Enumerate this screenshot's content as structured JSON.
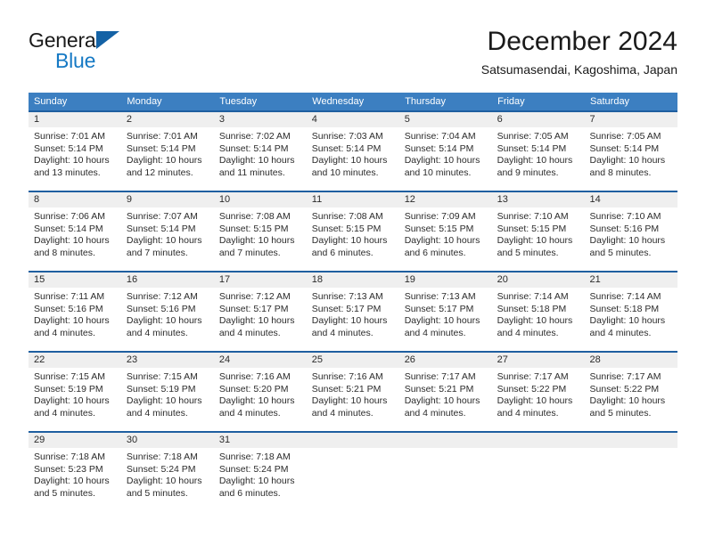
{
  "brand": {
    "name_part1": "General",
    "name_part2": "Blue",
    "triangle_color": "#1462a5",
    "blue_color": "#1579c4"
  },
  "header": {
    "month_title": "December 2024",
    "location": "Satsumasendai, Kagoshima, Japan"
  },
  "theme": {
    "header_row_bg": "#3c7fc1",
    "week_divider": "#1f5fa0",
    "daynum_bg": "#efefef",
    "text": "#2b2b2b"
  },
  "calendar": {
    "weekdays": [
      "Sunday",
      "Monday",
      "Tuesday",
      "Wednesday",
      "Thursday",
      "Friday",
      "Saturday"
    ],
    "weeks": [
      [
        {
          "day": "1",
          "sunrise": "Sunrise: 7:01 AM",
          "sunset": "Sunset: 5:14 PM",
          "daylight": "Daylight: 10 hours and 13 minutes."
        },
        {
          "day": "2",
          "sunrise": "Sunrise: 7:01 AM",
          "sunset": "Sunset: 5:14 PM",
          "daylight": "Daylight: 10 hours and 12 minutes."
        },
        {
          "day": "3",
          "sunrise": "Sunrise: 7:02 AM",
          "sunset": "Sunset: 5:14 PM",
          "daylight": "Daylight: 10 hours and 11 minutes."
        },
        {
          "day": "4",
          "sunrise": "Sunrise: 7:03 AM",
          "sunset": "Sunset: 5:14 PM",
          "daylight": "Daylight: 10 hours and 10 minutes."
        },
        {
          "day": "5",
          "sunrise": "Sunrise: 7:04 AM",
          "sunset": "Sunset: 5:14 PM",
          "daylight": "Daylight: 10 hours and 10 minutes."
        },
        {
          "day": "6",
          "sunrise": "Sunrise: 7:05 AM",
          "sunset": "Sunset: 5:14 PM",
          "daylight": "Daylight: 10 hours and 9 minutes."
        },
        {
          "day": "7",
          "sunrise": "Sunrise: 7:05 AM",
          "sunset": "Sunset: 5:14 PM",
          "daylight": "Daylight: 10 hours and 8 minutes."
        }
      ],
      [
        {
          "day": "8",
          "sunrise": "Sunrise: 7:06 AM",
          "sunset": "Sunset: 5:14 PM",
          "daylight": "Daylight: 10 hours and 8 minutes."
        },
        {
          "day": "9",
          "sunrise": "Sunrise: 7:07 AM",
          "sunset": "Sunset: 5:14 PM",
          "daylight": "Daylight: 10 hours and 7 minutes."
        },
        {
          "day": "10",
          "sunrise": "Sunrise: 7:08 AM",
          "sunset": "Sunset: 5:15 PM",
          "daylight": "Daylight: 10 hours and 7 minutes."
        },
        {
          "day": "11",
          "sunrise": "Sunrise: 7:08 AM",
          "sunset": "Sunset: 5:15 PM",
          "daylight": "Daylight: 10 hours and 6 minutes."
        },
        {
          "day": "12",
          "sunrise": "Sunrise: 7:09 AM",
          "sunset": "Sunset: 5:15 PM",
          "daylight": "Daylight: 10 hours and 6 minutes."
        },
        {
          "day": "13",
          "sunrise": "Sunrise: 7:10 AM",
          "sunset": "Sunset: 5:15 PM",
          "daylight": "Daylight: 10 hours and 5 minutes."
        },
        {
          "day": "14",
          "sunrise": "Sunrise: 7:10 AM",
          "sunset": "Sunset: 5:16 PM",
          "daylight": "Daylight: 10 hours and 5 minutes."
        }
      ],
      [
        {
          "day": "15",
          "sunrise": "Sunrise: 7:11 AM",
          "sunset": "Sunset: 5:16 PM",
          "daylight": "Daylight: 10 hours and 4 minutes."
        },
        {
          "day": "16",
          "sunrise": "Sunrise: 7:12 AM",
          "sunset": "Sunset: 5:16 PM",
          "daylight": "Daylight: 10 hours and 4 minutes."
        },
        {
          "day": "17",
          "sunrise": "Sunrise: 7:12 AM",
          "sunset": "Sunset: 5:17 PM",
          "daylight": "Daylight: 10 hours and 4 minutes."
        },
        {
          "day": "18",
          "sunrise": "Sunrise: 7:13 AM",
          "sunset": "Sunset: 5:17 PM",
          "daylight": "Daylight: 10 hours and 4 minutes."
        },
        {
          "day": "19",
          "sunrise": "Sunrise: 7:13 AM",
          "sunset": "Sunset: 5:17 PM",
          "daylight": "Daylight: 10 hours and 4 minutes."
        },
        {
          "day": "20",
          "sunrise": "Sunrise: 7:14 AM",
          "sunset": "Sunset: 5:18 PM",
          "daylight": "Daylight: 10 hours and 4 minutes."
        },
        {
          "day": "21",
          "sunrise": "Sunrise: 7:14 AM",
          "sunset": "Sunset: 5:18 PM",
          "daylight": "Daylight: 10 hours and 4 minutes."
        }
      ],
      [
        {
          "day": "22",
          "sunrise": "Sunrise: 7:15 AM",
          "sunset": "Sunset: 5:19 PM",
          "daylight": "Daylight: 10 hours and 4 minutes."
        },
        {
          "day": "23",
          "sunrise": "Sunrise: 7:15 AM",
          "sunset": "Sunset: 5:19 PM",
          "daylight": "Daylight: 10 hours and 4 minutes."
        },
        {
          "day": "24",
          "sunrise": "Sunrise: 7:16 AM",
          "sunset": "Sunset: 5:20 PM",
          "daylight": "Daylight: 10 hours and 4 minutes."
        },
        {
          "day": "25",
          "sunrise": "Sunrise: 7:16 AM",
          "sunset": "Sunset: 5:21 PM",
          "daylight": "Daylight: 10 hours and 4 minutes."
        },
        {
          "day": "26",
          "sunrise": "Sunrise: 7:17 AM",
          "sunset": "Sunset: 5:21 PM",
          "daylight": "Daylight: 10 hours and 4 minutes."
        },
        {
          "day": "27",
          "sunrise": "Sunrise: 7:17 AM",
          "sunset": "Sunset: 5:22 PM",
          "daylight": "Daylight: 10 hours and 4 minutes."
        },
        {
          "day": "28",
          "sunrise": "Sunrise: 7:17 AM",
          "sunset": "Sunset: 5:22 PM",
          "daylight": "Daylight: 10 hours and 5 minutes."
        }
      ],
      [
        {
          "day": "29",
          "sunrise": "Sunrise: 7:18 AM",
          "sunset": "Sunset: 5:23 PM",
          "daylight": "Daylight: 10 hours and 5 minutes."
        },
        {
          "day": "30",
          "sunrise": "Sunrise: 7:18 AM",
          "sunset": "Sunset: 5:24 PM",
          "daylight": "Daylight: 10 hours and 5 minutes."
        },
        {
          "day": "31",
          "sunrise": "Sunrise: 7:18 AM",
          "sunset": "Sunset: 5:24 PM",
          "daylight": "Daylight: 10 hours and 6 minutes."
        },
        {
          "day": "",
          "sunrise": "",
          "sunset": "",
          "daylight": ""
        },
        {
          "day": "",
          "sunrise": "",
          "sunset": "",
          "daylight": ""
        },
        {
          "day": "",
          "sunrise": "",
          "sunset": "",
          "daylight": ""
        },
        {
          "day": "",
          "sunrise": "",
          "sunset": "",
          "daylight": ""
        }
      ]
    ]
  }
}
